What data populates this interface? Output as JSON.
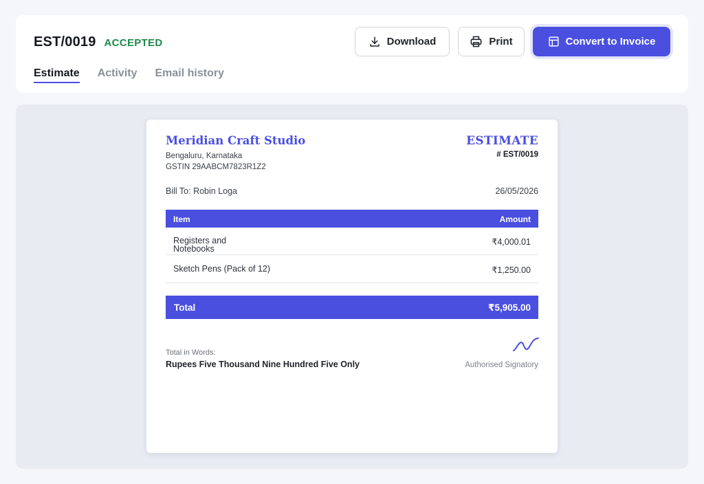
{
  "header": {
    "doc_number": "EST/0019",
    "status": "ACCEPTED",
    "actions": {
      "download_label": "Download",
      "print_label": "Print",
      "convert_label": "Convert to Invoice"
    },
    "tabs": [
      {
        "label": "Estimate",
        "active": true
      },
      {
        "label": "Activity",
        "active": false
      },
      {
        "label": "Email history",
        "active": false
      }
    ]
  },
  "document": {
    "company_name": "Meridian Craft Studio",
    "company_address": "Bengaluru, Karnataka",
    "company_gstin": "GSTIN 29AABCM7823R1Z2",
    "doc_type": "ESTIMATE",
    "doc_number": "# EST/0019",
    "bill_to": "Bill To: Robin Loga",
    "date": "26/05/2026",
    "table": {
      "headers": [
        "Item",
        "Amount"
      ],
      "rows": [
        {
          "item": "Registers and Notebooks",
          "amount": "₹4,000.01"
        },
        {
          "item": "Sketch Pens (Pack of 12)",
          "amount": "₹1,250.00"
        }
      ]
    },
    "total_label": "Total",
    "total_value": "₹5,905.00",
    "words_label": "Total in Words:",
    "words": "Rupees Five Thousand Nine Hundred Five Only",
    "signatory_label": "Authorised Signatory"
  },
  "colors": {
    "accent": "#4a4fe0",
    "status_green": "#1e8a4c",
    "background": "#f5f6fa",
    "preview_bg": "#e9ebf3"
  },
  "icons": {
    "download": "download-icon",
    "print": "printer-icon",
    "convert": "invoice-icon",
    "signature": "signature-icon"
  }
}
